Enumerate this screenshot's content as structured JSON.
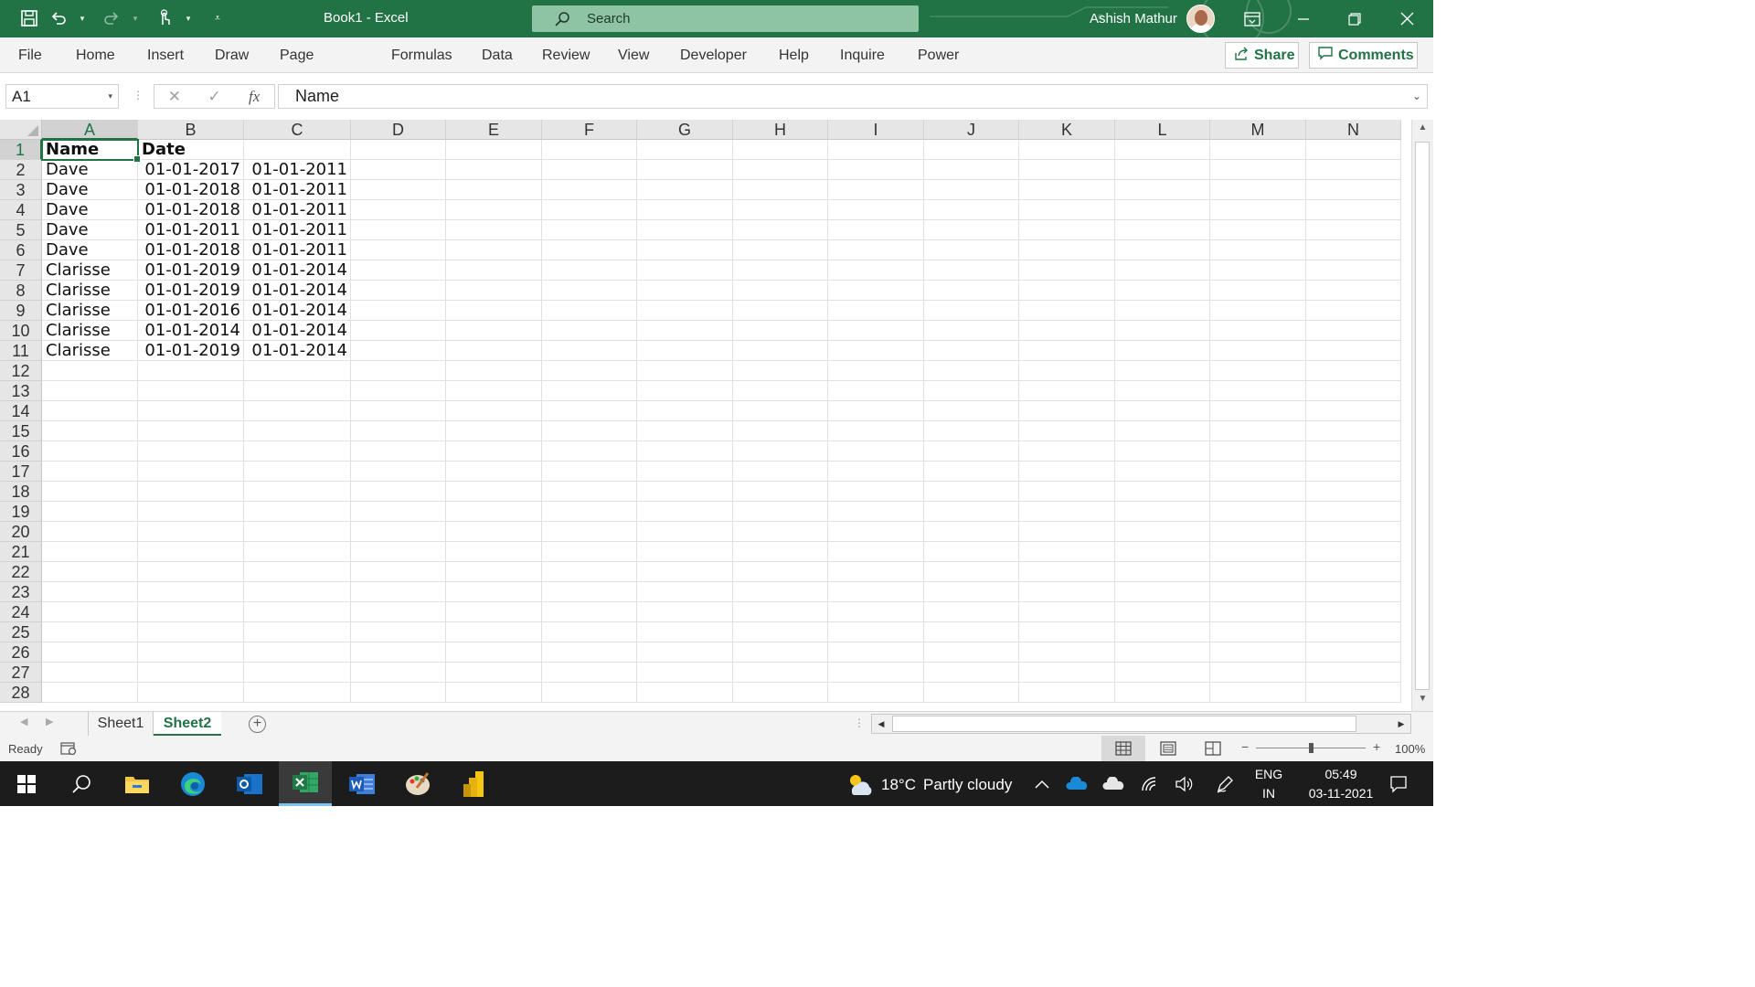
{
  "window": {
    "doc_title": "Book1  -  Excel",
    "search_placeholder": "Search",
    "user_name": "Ashish Mathur"
  },
  "ribbon": {
    "tabs": [
      "File",
      "Home",
      "Insert",
      "Draw",
      "Page Layout",
      "Formulas",
      "Data",
      "Review",
      "View",
      "Developer",
      "Help",
      "Inquire",
      "Power Pivot"
    ],
    "share_label": "Share",
    "comments_label": "Comments"
  },
  "formula_bar": {
    "name_box": "A1",
    "fx_label": "fx",
    "content": "Name"
  },
  "sheet": {
    "columns": [
      "A",
      "B",
      "C",
      "D",
      "E",
      "F",
      "G",
      "H",
      "I",
      "J",
      "K",
      "L",
      "M",
      "N"
    ],
    "rows": [
      "1",
      "2",
      "3",
      "4",
      "5",
      "6",
      "7",
      "8",
      "9",
      "10",
      "11",
      "12",
      "13",
      "14",
      "15",
      "16",
      "17",
      "18",
      "19",
      "20",
      "21",
      "22",
      "23",
      "24",
      "25",
      "26",
      "27",
      "28"
    ],
    "selected_cell": "A1",
    "data": [
      [
        "Name",
        "Date",
        ""
      ],
      [
        "Dave",
        "01-01-2017",
        "01-01-2011"
      ],
      [
        "Dave",
        "01-01-2018",
        "01-01-2011"
      ],
      [
        "Dave",
        "01-01-2018",
        "01-01-2011"
      ],
      [
        "Dave",
        "01-01-2011",
        "01-01-2011"
      ],
      [
        "Dave",
        "01-01-2018",
        "01-01-2011"
      ],
      [
        "Clarisse",
        "01-01-2019",
        "01-01-2014"
      ],
      [
        "Clarisse",
        "01-01-2019",
        "01-01-2014"
      ],
      [
        "Clarisse",
        "01-01-2016",
        "01-01-2014"
      ],
      [
        "Clarisse",
        "01-01-2014",
        "01-01-2014"
      ],
      [
        "Clarisse",
        "01-01-2019",
        "01-01-2014"
      ]
    ]
  },
  "sheet_tabs": {
    "tabs": [
      "Sheet1",
      "Sheet2"
    ],
    "active": "Sheet2"
  },
  "status": {
    "ready": "Ready",
    "zoom": "100%"
  },
  "taskbar": {
    "weather_temp": "18°C",
    "weather_text": "Partly cloudy",
    "lang_line1": "ENG",
    "lang_line2": "IN",
    "time": "05:49",
    "date": "03-11-2021"
  },
  "colors": {
    "excel_green": "#217346",
    "ribbon_bg": "#f3f3f3",
    "taskbar_bg": "#1c1c1c"
  }
}
